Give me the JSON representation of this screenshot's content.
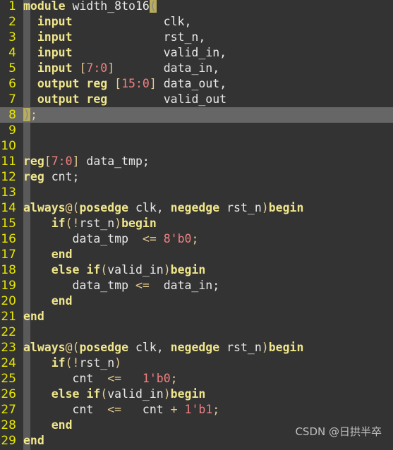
{
  "editor": {
    "current_line": 8,
    "colors": {
      "background": "#333333",
      "keyword": "#f0e68c",
      "identifier": "#e8e8e8",
      "punctuation": "#e6cc90",
      "number": "#f08080",
      "line_number": "#e6e600"
    },
    "lines": [
      [
        [
          "k",
          "module"
        ],
        [
          "i",
          " width_8to16"
        ],
        [
          "m",
          "("
        ]
      ],
      [
        [
          "i",
          "  "
        ],
        [
          "k",
          "input"
        ],
        [
          "i",
          "             clk,"
        ]
      ],
      [
        [
          "i",
          "  "
        ],
        [
          "k",
          "input"
        ],
        [
          "i",
          "             rst_n,"
        ]
      ],
      [
        [
          "i",
          "  "
        ],
        [
          "k",
          "input"
        ],
        [
          "i",
          "             valid_in,"
        ]
      ],
      [
        [
          "i",
          "  "
        ],
        [
          "k",
          "input"
        ],
        [
          "i",
          " "
        ],
        [
          "p",
          "["
        ],
        [
          "n",
          "7:0"
        ],
        [
          "p",
          "]"
        ],
        [
          "i",
          "       data_in,"
        ]
      ],
      [
        [
          "i",
          "  "
        ],
        [
          "k",
          "output"
        ],
        [
          "i",
          " "
        ],
        [
          "k",
          "reg"
        ],
        [
          "i",
          " "
        ],
        [
          "p",
          "["
        ],
        [
          "n",
          "15:0"
        ],
        [
          "p",
          "]"
        ],
        [
          "i",
          " data_out,"
        ]
      ],
      [
        [
          "i",
          "  "
        ],
        [
          "k",
          "output"
        ],
        [
          "i",
          " "
        ],
        [
          "k",
          "reg"
        ],
        [
          "i",
          "        valid_out"
        ]
      ],
      [
        [
          "m",
          ")"
        ],
        [
          "p",
          ";"
        ]
      ],
      [],
      [],
      [
        [
          "k",
          "reg"
        ],
        [
          "p",
          "["
        ],
        [
          "n",
          "7:0"
        ],
        [
          "p",
          "]"
        ],
        [
          "i",
          " data_tmp;"
        ]
      ],
      [
        [
          "k",
          "reg"
        ],
        [
          "i",
          " cnt;"
        ]
      ],
      [],
      [
        [
          "k",
          "always"
        ],
        [
          "p",
          "@("
        ],
        [
          "k",
          "posedge"
        ],
        [
          "i",
          " clk, "
        ],
        [
          "k",
          "negedge"
        ],
        [
          "i",
          " rst_n"
        ],
        [
          "p",
          ")"
        ],
        [
          "k",
          "begin"
        ]
      ],
      [
        [
          "i",
          "    "
        ],
        [
          "k",
          "if"
        ],
        [
          "p",
          "(!"
        ],
        [
          "i",
          "rst_n"
        ],
        [
          "p",
          ")"
        ],
        [
          "k",
          "begin"
        ]
      ],
      [
        [
          "i",
          "       data_tmp  "
        ],
        [
          "p",
          "<="
        ],
        [
          "i",
          " "
        ],
        [
          "n",
          "8'b0"
        ],
        [
          "p",
          ";"
        ]
      ],
      [
        [
          "i",
          "    "
        ],
        [
          "k",
          "end"
        ]
      ],
      [
        [
          "i",
          "    "
        ],
        [
          "k",
          "else"
        ],
        [
          "i",
          " "
        ],
        [
          "k",
          "if"
        ],
        [
          "p",
          "("
        ],
        [
          "i",
          "valid_in"
        ],
        [
          "p",
          ")"
        ],
        [
          "k",
          "begin"
        ]
      ],
      [
        [
          "i",
          "       data_tmp "
        ],
        [
          "p",
          "<="
        ],
        [
          "i",
          "  data_in;"
        ]
      ],
      [
        [
          "i",
          "    "
        ],
        [
          "k",
          "end"
        ]
      ],
      [
        [
          "k",
          "end"
        ]
      ],
      [],
      [
        [
          "k",
          "always"
        ],
        [
          "p",
          "@("
        ],
        [
          "k",
          "posedge"
        ],
        [
          "i",
          " clk, "
        ],
        [
          "k",
          "negedge"
        ],
        [
          "i",
          " rst_n"
        ],
        [
          "p",
          ")"
        ],
        [
          "k",
          "begin"
        ]
      ],
      [
        [
          "i",
          "    "
        ],
        [
          "k",
          "if"
        ],
        [
          "p",
          "(!"
        ],
        [
          "i",
          "rst_n"
        ],
        [
          "p",
          ")"
        ]
      ],
      [
        [
          "i",
          "       cnt  "
        ],
        [
          "p",
          "<="
        ],
        [
          "i",
          "   "
        ],
        [
          "n",
          "1'b0"
        ],
        [
          "p",
          ";"
        ]
      ],
      [
        [
          "i",
          "    "
        ],
        [
          "k",
          "else"
        ],
        [
          "i",
          " "
        ],
        [
          "k",
          "if"
        ],
        [
          "p",
          "("
        ],
        [
          "i",
          "valid_in"
        ],
        [
          "p",
          ")"
        ],
        [
          "k",
          "begin"
        ]
      ],
      [
        [
          "i",
          "       cnt  "
        ],
        [
          "p",
          "<="
        ],
        [
          "i",
          "   cnt "
        ],
        [
          "p",
          "+"
        ],
        [
          "i",
          " "
        ],
        [
          "n",
          "1'b1"
        ],
        [
          "p",
          ";"
        ]
      ],
      [
        [
          "i",
          "    "
        ],
        [
          "k",
          "end"
        ]
      ],
      [
        [
          "k",
          "end"
        ]
      ]
    ]
  },
  "watermark": "CSDN @日拱半卒"
}
